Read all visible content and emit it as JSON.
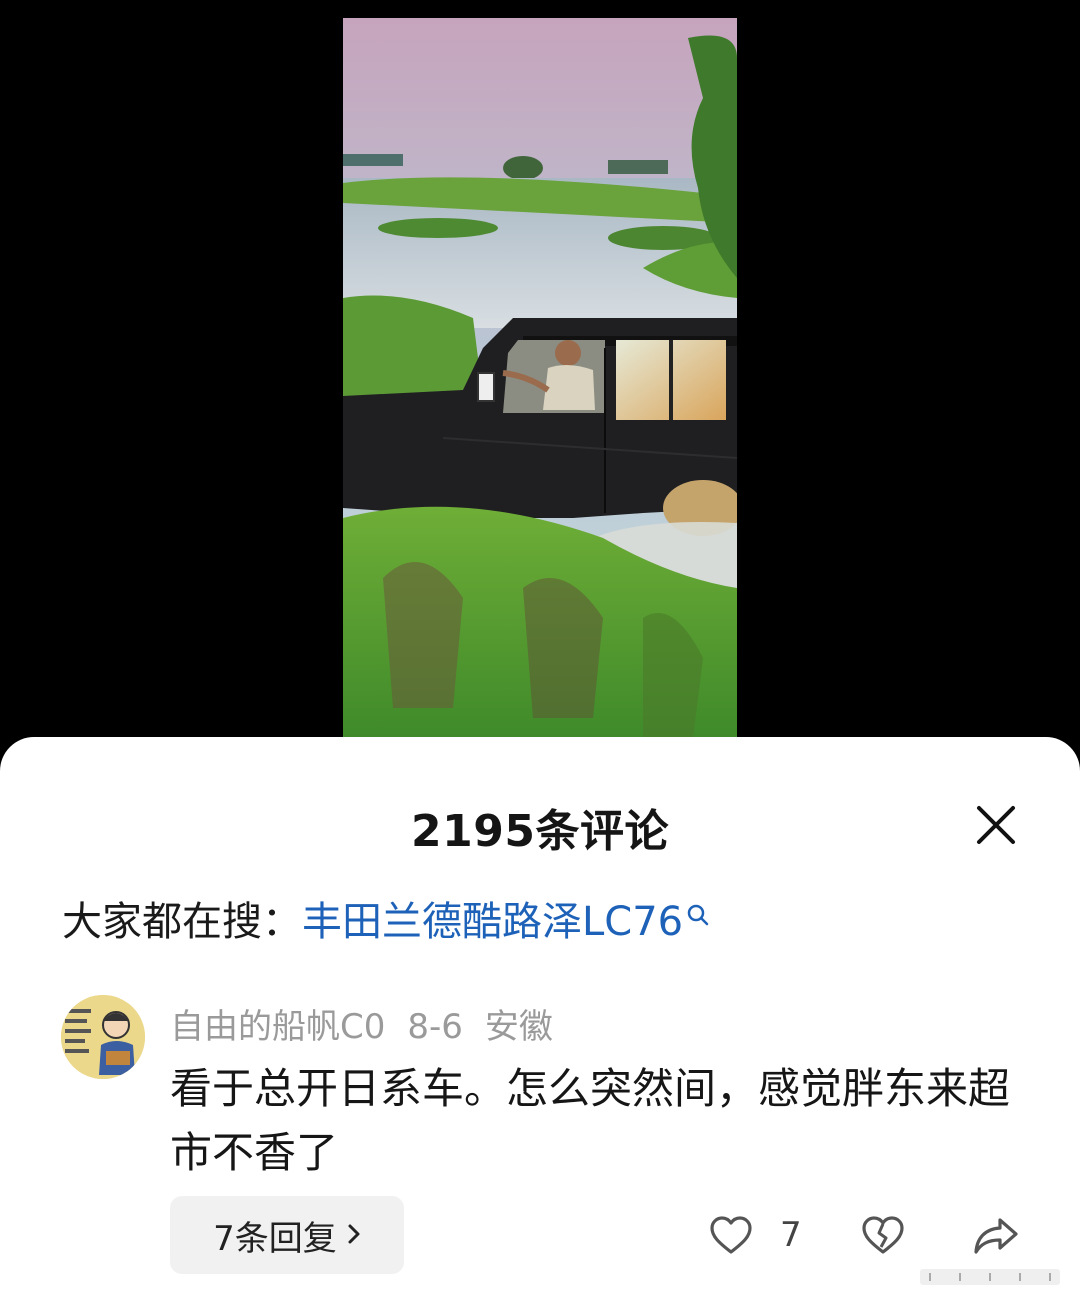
{
  "video": {
    "icon": "video-frame"
  },
  "comments_panel": {
    "title": "2195条评论",
    "close_icon": "close-icon",
    "search_prefix": "大家都在搜：",
    "search_term": "丰田兰德酷路泽LC76"
  },
  "comment": {
    "username": "自由的船帆C0",
    "date": "8-6",
    "location": "安徽",
    "text": "看于总开日系车。怎么突然间，感觉胖东来超市不香了",
    "replies_label": "7条回复",
    "like_count": "7"
  },
  "colors": {
    "accent_link": "#1d62b8",
    "sheet_bg": "#ffffff",
    "backdrop": "#000000"
  }
}
